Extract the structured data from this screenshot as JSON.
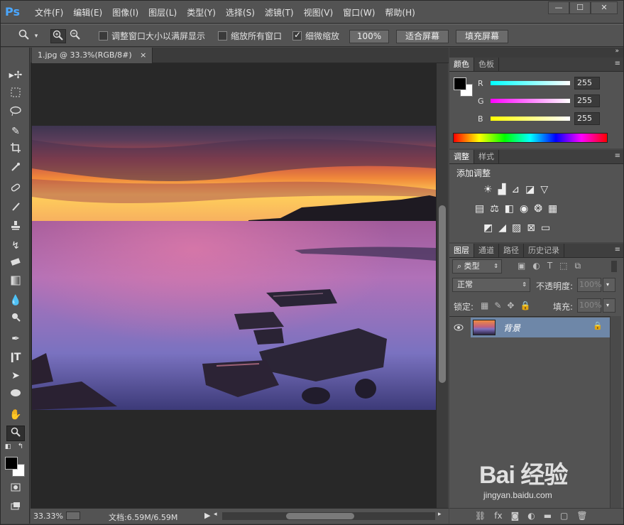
{
  "app": {
    "logo": "Ps"
  },
  "menu": [
    "文件(F)",
    "编辑(E)",
    "图像(I)",
    "图层(L)",
    "类型(Y)",
    "选择(S)",
    "滤镜(T)",
    "视图(V)",
    "窗口(W)",
    "帮助(H)"
  ],
  "window_buttons": [
    "—",
    "☐",
    "✕"
  ],
  "options": {
    "resize_windows_label": "调整窗口大小以满屏显示",
    "zoom_all_label": "缩放所有窗口",
    "scrubby_zoom_label": "细微缩放",
    "btn_100": "100%",
    "btn_fit": "适合屏幕",
    "btn_fill": "填充屏幕"
  },
  "document": {
    "tab_title": "1.jpg @ 33.3%(RGB/8#)",
    "tab_close": "×",
    "zoom": "33.33%",
    "doc_size": "文档:6.59M/6.59M"
  },
  "color_panel": {
    "tabs": [
      "颜色",
      "色板"
    ],
    "r_label": "R",
    "g_label": "G",
    "b_label": "B",
    "r": "255",
    "g": "255",
    "b": "255"
  },
  "adjust_panel": {
    "tabs": [
      "调整",
      "样式"
    ],
    "title": "添加调整"
  },
  "layers_panel": {
    "tabs": [
      "图层",
      "通道",
      "路径",
      "历史记录"
    ],
    "filter_kind": "类型",
    "blend_mode": "正常",
    "opacity_label": "不透明度:",
    "opacity": "100%",
    "lock_label": "锁定:",
    "fill_label": "填充:",
    "fill": "100%",
    "layer_name": "背景"
  },
  "watermark": {
    "text": "Bai 经验",
    "url": "jingyan.baidu.com"
  },
  "colors": {
    "accent": "#4aa7ff",
    "panel": "#535353",
    "canvas": "#282828",
    "layer_selected": "#6e87a8"
  }
}
